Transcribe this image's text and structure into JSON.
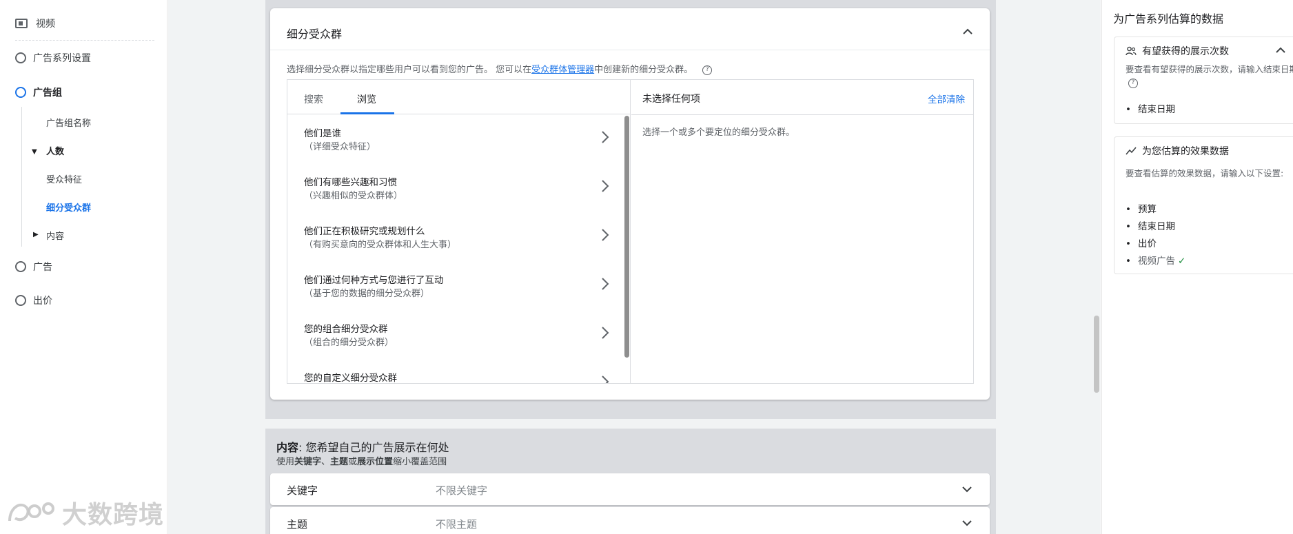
{
  "sidebar": {
    "video_label": "视频",
    "items": [
      {
        "label": "广告系列设置"
      },
      {
        "label": "广告组"
      },
      {
        "label": "广告"
      },
      {
        "label": "出价"
      }
    ],
    "sub": {
      "group_name": "广告组名称",
      "people": "人数",
      "features": "受众特征",
      "segments": "细分受众群",
      "content": "内容"
    }
  },
  "segments_card": {
    "title": "细分受众群",
    "desc_prefix": "选择细分受众群以指定哪些用户可以看到您的广告。 您可以在",
    "desc_link": "受众群体管理器",
    "desc_suffix": "中创建新的细分受众群。",
    "help_glyph": "?",
    "tabs": [
      "搜索",
      "浏览"
    ],
    "categories": [
      {
        "title": "他们是谁",
        "sub": "（详细受众特征）"
      },
      {
        "title": "他们有哪些兴趣和习惯",
        "sub": "（兴趣相似的受众群体）"
      },
      {
        "title": "他们正在积极研究或规划什么",
        "sub": "（有购买意向的受众群体和人生大事）"
      },
      {
        "title": "他们通过何种方式与您进行了互动",
        "sub": "（基于您的数据的细分受众群）"
      },
      {
        "title": "您的组合细分受众群",
        "sub": "（组合的细分受众群）"
      },
      {
        "title": "您的自定义细分受众群",
        "sub": ""
      }
    ],
    "selected_header": "未选择任何项",
    "clear_all": "全部清除",
    "selected_hint": "选择一个或多个要定位的细分受众群。"
  },
  "content_section": {
    "title_bold": "内容",
    "title_rest": ": 您希望自己的广告展示在何处",
    "sub_pre": "使用",
    "sub_k1": "关键字",
    "sub_sep": "、",
    "sub_k2": "主题",
    "sub_or": "或",
    "sub_k3": "展示位置",
    "sub_post": "缩小覆盖范围",
    "rows": [
      {
        "label": "关键字",
        "value": "不限关键字"
      },
      {
        "label": "主题",
        "value": "不限主题"
      }
    ]
  },
  "right_column": {
    "title": "为广告系列估算的数据",
    "impressions": {
      "title": "有望获得的展示次数",
      "desc": "要查看有望获得的展示次数，请输入结束日期",
      "items": [
        "结束日期"
      ]
    },
    "performance": {
      "title": "为您估算的效果数据",
      "desc": "要查看估算的效果数据，请输入以下设置:",
      "items": [
        "预算",
        "结束日期",
        "出价"
      ],
      "done_item": "视频广告",
      "check": "✓"
    }
  },
  "watermark": "大数跨境",
  "colors": {
    "accent": "#1a73e8",
    "check": "#1e8e3e",
    "panel": "#dadce0"
  }
}
